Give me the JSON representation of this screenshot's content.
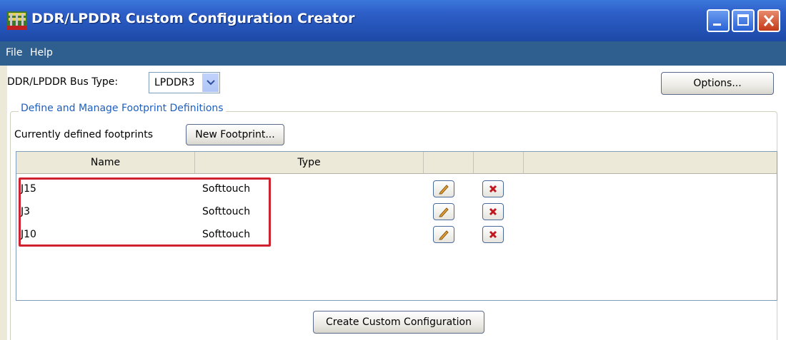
{
  "window": {
    "title": "DDR/LPDDR Custom Configuration Creator",
    "colors": {
      "titlebar": "#2453b6",
      "menubar": "#2f5f8f",
      "group_title": "#1f5fbf",
      "highlight": "#d0212f"
    }
  },
  "menu": {
    "items": [
      "File",
      "Help"
    ]
  },
  "bus": {
    "label": "DDR/LPDDR Bus Type:",
    "selected": "LPDDR3"
  },
  "options_button": "Options...",
  "footprints": {
    "group_title": "Define and Manage Footprint Definitions",
    "currently_defined_label": "Currently defined footprints",
    "new_button": "New Footprint...",
    "columns": [
      "Name",
      "Type",
      "",
      ""
    ],
    "rows": [
      {
        "name": "J15",
        "type": "Softtouch"
      },
      {
        "name": "J3",
        "type": "Softtouch"
      },
      {
        "name": "J10",
        "type": "Softtouch"
      }
    ],
    "row_icons": {
      "edit": "pencil-icon",
      "delete": "red-x-icon"
    }
  },
  "create_button": "Create Custom Configuration"
}
